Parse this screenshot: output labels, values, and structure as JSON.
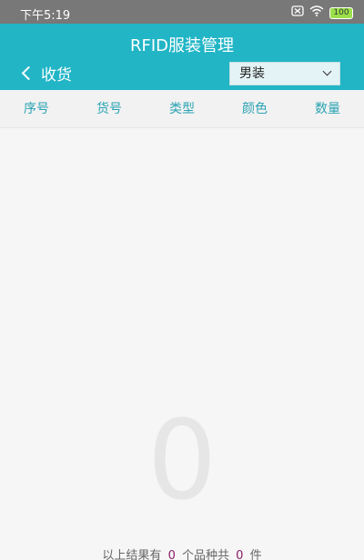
{
  "status": {
    "time": "下午5:19",
    "battery": "100"
  },
  "header": {
    "app_title": "RFID服装管理",
    "back_label": "收货",
    "select_value": "男装"
  },
  "table": {
    "columns": [
      "序号",
      "货号",
      "类型",
      "颜色",
      "数量"
    ]
  },
  "big_count": "0",
  "summary": {
    "prefix": "以上结果有",
    "item_count": "0",
    "middle": "个品种共",
    "piece_count": "0",
    "suffix": "件"
  }
}
